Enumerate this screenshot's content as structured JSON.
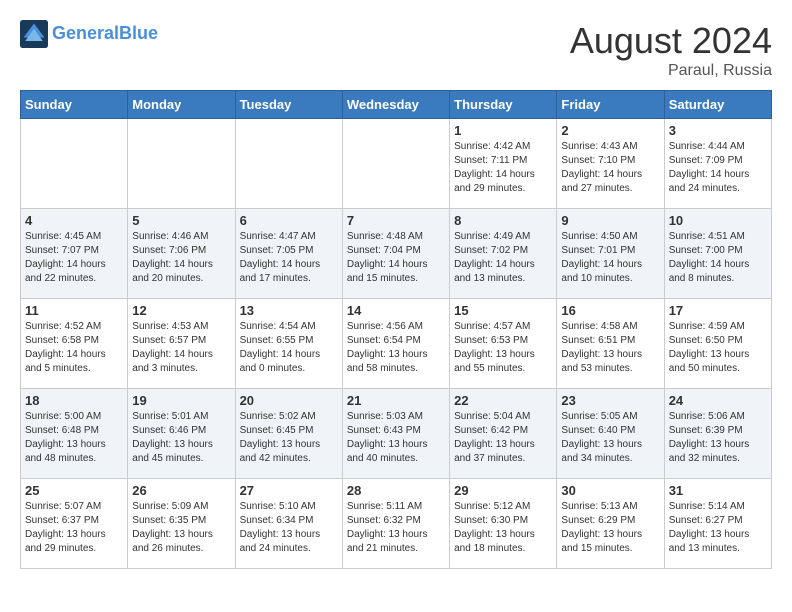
{
  "header": {
    "logo_line1": "General",
    "logo_line2": "Blue",
    "month_year": "August 2024",
    "location": "Paraul, Russia"
  },
  "weekdays": [
    "Sunday",
    "Monday",
    "Tuesday",
    "Wednesday",
    "Thursday",
    "Friday",
    "Saturday"
  ],
  "weeks": [
    [
      {
        "day": "",
        "content": ""
      },
      {
        "day": "",
        "content": ""
      },
      {
        "day": "",
        "content": ""
      },
      {
        "day": "",
        "content": ""
      },
      {
        "day": "1",
        "content": "Sunrise: 4:42 AM\nSunset: 7:11 PM\nDaylight: 14 hours\nand 29 minutes."
      },
      {
        "day": "2",
        "content": "Sunrise: 4:43 AM\nSunset: 7:10 PM\nDaylight: 14 hours\nand 27 minutes."
      },
      {
        "day": "3",
        "content": "Sunrise: 4:44 AM\nSunset: 7:09 PM\nDaylight: 14 hours\nand 24 minutes."
      }
    ],
    [
      {
        "day": "4",
        "content": "Sunrise: 4:45 AM\nSunset: 7:07 PM\nDaylight: 14 hours\nand 22 minutes."
      },
      {
        "day": "5",
        "content": "Sunrise: 4:46 AM\nSunset: 7:06 PM\nDaylight: 14 hours\nand 20 minutes."
      },
      {
        "day": "6",
        "content": "Sunrise: 4:47 AM\nSunset: 7:05 PM\nDaylight: 14 hours\nand 17 minutes."
      },
      {
        "day": "7",
        "content": "Sunrise: 4:48 AM\nSunset: 7:04 PM\nDaylight: 14 hours\nand 15 minutes."
      },
      {
        "day": "8",
        "content": "Sunrise: 4:49 AM\nSunset: 7:02 PM\nDaylight: 14 hours\nand 13 minutes."
      },
      {
        "day": "9",
        "content": "Sunrise: 4:50 AM\nSunset: 7:01 PM\nDaylight: 14 hours\nand 10 minutes."
      },
      {
        "day": "10",
        "content": "Sunrise: 4:51 AM\nSunset: 7:00 PM\nDaylight: 14 hours\nand 8 minutes."
      }
    ],
    [
      {
        "day": "11",
        "content": "Sunrise: 4:52 AM\nSunset: 6:58 PM\nDaylight: 14 hours\nand 5 minutes."
      },
      {
        "day": "12",
        "content": "Sunrise: 4:53 AM\nSunset: 6:57 PM\nDaylight: 14 hours\nand 3 minutes."
      },
      {
        "day": "13",
        "content": "Sunrise: 4:54 AM\nSunset: 6:55 PM\nDaylight: 14 hours\nand 0 minutes."
      },
      {
        "day": "14",
        "content": "Sunrise: 4:56 AM\nSunset: 6:54 PM\nDaylight: 13 hours\nand 58 minutes."
      },
      {
        "day": "15",
        "content": "Sunrise: 4:57 AM\nSunset: 6:53 PM\nDaylight: 13 hours\nand 55 minutes."
      },
      {
        "day": "16",
        "content": "Sunrise: 4:58 AM\nSunset: 6:51 PM\nDaylight: 13 hours\nand 53 minutes."
      },
      {
        "day": "17",
        "content": "Sunrise: 4:59 AM\nSunset: 6:50 PM\nDaylight: 13 hours\nand 50 minutes."
      }
    ],
    [
      {
        "day": "18",
        "content": "Sunrise: 5:00 AM\nSunset: 6:48 PM\nDaylight: 13 hours\nand 48 minutes."
      },
      {
        "day": "19",
        "content": "Sunrise: 5:01 AM\nSunset: 6:46 PM\nDaylight: 13 hours\nand 45 minutes."
      },
      {
        "day": "20",
        "content": "Sunrise: 5:02 AM\nSunset: 6:45 PM\nDaylight: 13 hours\nand 42 minutes."
      },
      {
        "day": "21",
        "content": "Sunrise: 5:03 AM\nSunset: 6:43 PM\nDaylight: 13 hours\nand 40 minutes."
      },
      {
        "day": "22",
        "content": "Sunrise: 5:04 AM\nSunset: 6:42 PM\nDaylight: 13 hours\nand 37 minutes."
      },
      {
        "day": "23",
        "content": "Sunrise: 5:05 AM\nSunset: 6:40 PM\nDaylight: 13 hours\nand 34 minutes."
      },
      {
        "day": "24",
        "content": "Sunrise: 5:06 AM\nSunset: 6:39 PM\nDaylight: 13 hours\nand 32 minutes."
      }
    ],
    [
      {
        "day": "25",
        "content": "Sunrise: 5:07 AM\nSunset: 6:37 PM\nDaylight: 13 hours\nand 29 minutes."
      },
      {
        "day": "26",
        "content": "Sunrise: 5:09 AM\nSunset: 6:35 PM\nDaylight: 13 hours\nand 26 minutes."
      },
      {
        "day": "27",
        "content": "Sunrise: 5:10 AM\nSunset: 6:34 PM\nDaylight: 13 hours\nand 24 minutes."
      },
      {
        "day": "28",
        "content": "Sunrise: 5:11 AM\nSunset: 6:32 PM\nDaylight: 13 hours\nand 21 minutes."
      },
      {
        "day": "29",
        "content": "Sunrise: 5:12 AM\nSunset: 6:30 PM\nDaylight: 13 hours\nand 18 minutes."
      },
      {
        "day": "30",
        "content": "Sunrise: 5:13 AM\nSunset: 6:29 PM\nDaylight: 13 hours\nand 15 minutes."
      },
      {
        "day": "31",
        "content": "Sunrise: 5:14 AM\nSunset: 6:27 PM\nDaylight: 13 hours\nand 13 minutes."
      }
    ]
  ]
}
